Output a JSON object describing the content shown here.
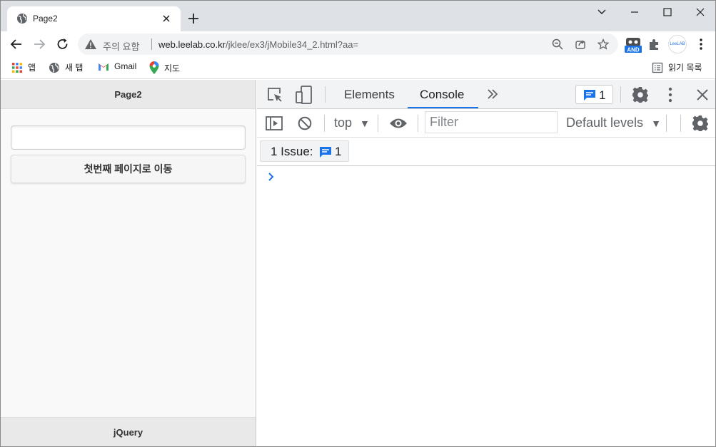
{
  "browser": {
    "tab_title": "Page2",
    "security_label": "주의 요함",
    "url_host": "web.leelab.co.kr",
    "url_path": "/jklee/ex3/jMobile34_2.html?aa=",
    "ext_and_label": "AND",
    "ext_leelab_label": "LeeLAB"
  },
  "bookmarks": {
    "apps": "앱",
    "new_tab": "새 탭",
    "gmail": "Gmail",
    "maps": "지도",
    "reading_list": "읽기 목록"
  },
  "page": {
    "header_title": "Page2",
    "input_value": "",
    "button_label": "첫번째 페이지로 이동",
    "footer_title": "jQuery"
  },
  "devtools": {
    "tabs": [
      "Elements",
      "Console"
    ],
    "active_tab": "Console",
    "issue_count": "1",
    "context": "top",
    "filter_placeholder": "Filter",
    "levels": "Default levels",
    "issues_label": "1 Issue:",
    "issues_count": "1",
    "accent_color": "#1a73e8"
  }
}
